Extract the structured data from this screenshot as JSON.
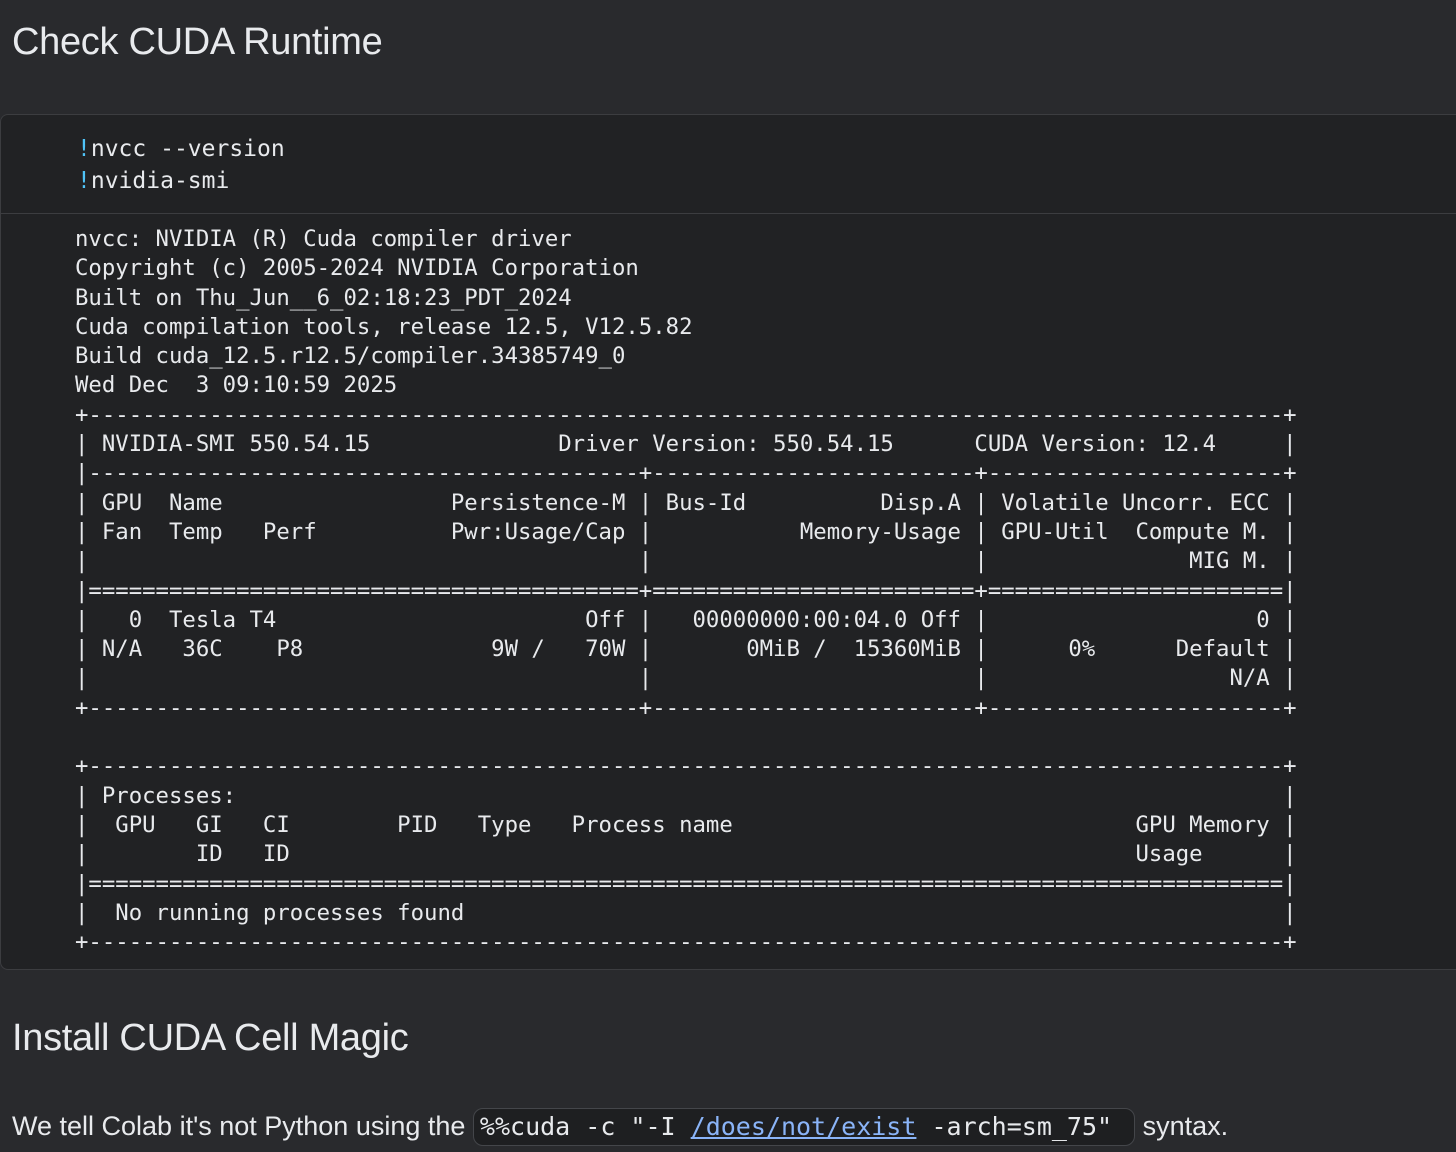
{
  "sections": [
    {
      "title": "Check CUDA Runtime"
    },
    {
      "title": "Install CUDA Cell Magic"
    }
  ],
  "cell": {
    "code_lines": [
      {
        "prefix": "!",
        "text": "nvcc --version"
      },
      {
        "prefix": "!",
        "text": "nvidia-smi"
      }
    ],
    "output": "nvcc: NVIDIA (R) Cuda compiler driver\nCopyright (c) 2005-2024 NVIDIA Corporation\nBuilt on Thu_Jun__6_02:18:23_PDT_2024\nCuda compilation tools, release 12.5, V12.5.82\nBuild cuda_12.5.r12.5/compiler.34385749_0\nWed Dec  3 09:10:59 2025\n+-----------------------------------------------------------------------------------------+\n| NVIDIA-SMI 550.54.15              Driver Version: 550.54.15      CUDA Version: 12.4     |\n|-----------------------------------------+------------------------+----------------------+\n| GPU  Name                 Persistence-M | Bus-Id          Disp.A | Volatile Uncorr. ECC |\n| Fan  Temp   Perf          Pwr:Usage/Cap |           Memory-Usage | GPU-Util  Compute M. |\n|                                         |                        |               MIG M. |\n|=========================================+========================+======================|\n|   0  Tesla T4                       Off |   00000000:00:04.0 Off |                    0 |\n| N/A   36C    P8              9W /   70W |       0MiB /  15360MiB |      0%      Default |\n|                                         |                        |                  N/A |\n+-----------------------------------------+------------------------+----------------------+\n\n+-----------------------------------------------------------------------------------------+\n| Processes:                                                                              |\n|  GPU   GI   CI        PID   Type   Process name                              GPU Memory |\n|        ID   ID                                                               Usage      |\n|=========================================================================================|\n|  No running processes found                                                             |\n+-----------------------------------------------------------------------------------------+"
  },
  "paragraph": {
    "before": "We tell Colab it's not Python using the ",
    "code_start": "%%cuda -c \"-I ",
    "code_link": "/does/not/exist",
    "code_end": " -arch=sm_75\"",
    "after": " syntax."
  }
}
